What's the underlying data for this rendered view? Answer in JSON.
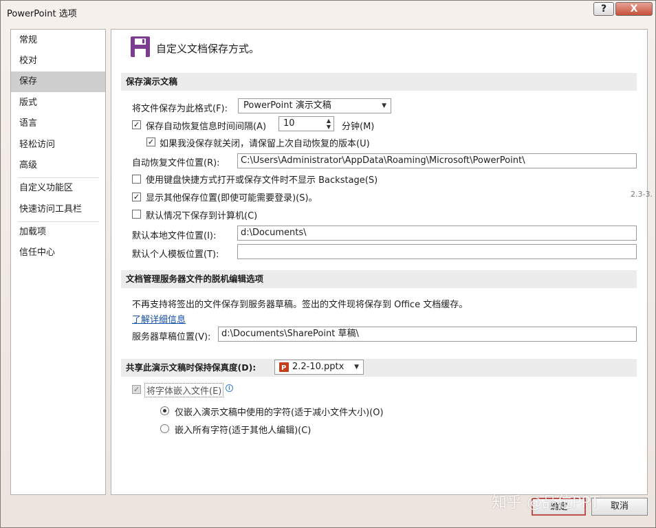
{
  "window": {
    "title": "PowerPoint 选项",
    "help_symbol": "?",
    "close_symbol": "X"
  },
  "sidebar": {
    "items": [
      {
        "label": "常规"
      },
      {
        "label": "校对"
      },
      {
        "label": "保存",
        "selected": true
      },
      {
        "label": "版式"
      },
      {
        "label": "语言"
      },
      {
        "label": "轻松访问"
      },
      {
        "label": "高级"
      },
      {
        "label": "自定义功能区"
      },
      {
        "label": "快速访问工具栏"
      },
      {
        "label": "加载项"
      },
      {
        "label": "信任中心"
      }
    ]
  },
  "main": {
    "page_title": "自定义文档保存方式。",
    "section_save": {
      "title": "保存演示文稿",
      "format_label": "将文件保存为此格式(F):",
      "format_value": "PowerPoint 演示文稿",
      "autorecover_label": "保存自动恢复信息时间间隔(A)",
      "autorecover_checked": true,
      "autorecover_minutes": "10",
      "minutes_label": "分钟(M)",
      "keep_last_label": "如果我没保存就关闭，请保留上次自动恢复的版本(U)",
      "keep_last_checked": true,
      "autorecover_location_label": "自动恢复文件位置(R):",
      "autorecover_location_value": "C:\\Users\\Administrator\\AppData\\Roaming\\Microsoft\\PowerPoint\\",
      "no_backstage_label": "使用键盘快捷方式打开或保存文件时不显示 Backstage(S)",
      "no_backstage_checked": false,
      "show_other_label": "显示其他保存位置(即使可能需要登录)(S)。",
      "show_other_checked": true,
      "save_to_computer_label": "默认情况下保存到计算机(C)",
      "save_to_computer_checked": false,
      "local_location_label": "默认本地文件位置(I):",
      "local_location_value": "d:\\Documents\\",
      "template_location_label": "默认个人模板位置(T):",
      "template_location_value": ""
    },
    "section_offline": {
      "title": "文档管理服务器文件的脱机编辑选项",
      "note": "不再支持将签出的文件保存到服务器草稿。签出的文件现将保存到 Office 文档缓存。",
      "learn_more": "了解详细信息",
      "drafts_label": "服务器草稿位置(V):",
      "drafts_value": "d:\\Documents\\SharePoint 草稿\\"
    },
    "section_fidelity": {
      "title": "共享此演示文稿时保持保真度(D):",
      "file_value": "2.2-10.pptx",
      "embed_fonts_label": "将字体嵌入文件(E)",
      "embed_fonts_checked": true,
      "embed_used_label": "仅嵌入演示文稿中使用的字符(适于减小文件大小)(O)",
      "embed_used_selected": true,
      "embed_all_label": "嵌入所有字符(适于其他人编辑)(C)",
      "embed_all_selected": false
    }
  },
  "footer": {
    "ok_label": "确定",
    "cancel_label": "取消"
  },
  "overlay": {
    "watermark": "知乎 @品位PPT",
    "side_fragment": "2.3-3."
  },
  "colors": {
    "accent_purple": "#7a3d8f",
    "selected_nav": "#cfcfcf",
    "link": "#1550a8",
    "pptx_red": "#c43e1c"
  }
}
